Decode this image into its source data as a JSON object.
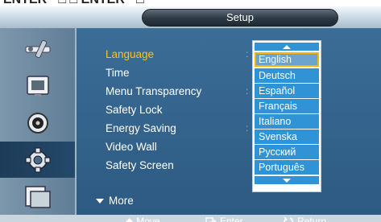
{
  "top_fragment": {
    "text": "ENTER  ·  □    □   ENTER  ·  □"
  },
  "title": "Setup",
  "icons": [
    {
      "name": "tools-icon"
    },
    {
      "name": "picture-icon"
    },
    {
      "name": "sound-icon"
    },
    {
      "name": "setup-icon",
      "selected": true
    },
    {
      "name": "input-icon"
    }
  ],
  "menu": {
    "items": [
      {
        "label": "Language",
        "active": true,
        "colon": true
      },
      {
        "label": "Time"
      },
      {
        "label": "Menu Transparency",
        "colon": true
      },
      {
        "label": "Safety Lock"
      },
      {
        "label": "Energy Saving",
        "colon": true
      },
      {
        "label": "Video Wall"
      },
      {
        "label": "Safety Screen"
      }
    ],
    "more_label": "More"
  },
  "language_dropdown": {
    "selected": "English",
    "options": [
      "English",
      "Deutsch",
      "Español",
      "Français",
      "Italiano",
      "Svenska",
      "Русский",
      "Português"
    ]
  },
  "footer": {
    "move_label": "Move",
    "enter_label": "Enter",
    "return_label": "Return"
  },
  "colors": {
    "background": "#2f5c83",
    "active_text": "#ffc21a",
    "dropdown_item": "#2f93d6",
    "dropdown_highlight": "#f5b400"
  }
}
